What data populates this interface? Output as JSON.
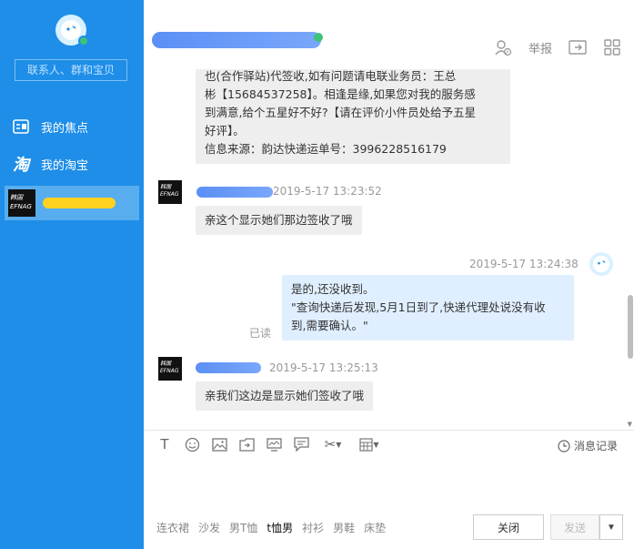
{
  "sidebar": {
    "search_placeholder": "联系人、群和宝贝",
    "nav": [
      {
        "label": "我的焦点",
        "icon": "focus-icon"
      },
      {
        "label": "我的淘宝",
        "icon": "taobao-icon"
      }
    ],
    "active_contact_logo_text": "韩国 EFNAG"
  },
  "header": {
    "report_label": "举报",
    "icons": [
      "user-add-icon",
      "report-label",
      "share-icon",
      "apps-icon"
    ]
  },
  "messages": {
    "first_bubble_lines": [
      "也(合作驿站)代签收,如有问题请电联业务员：王总",
      "彬【15684537258】。相逢是缘,如果您对我的服务感",
      "到满意,给个五星好不好?【请在评价小件员处给予五星",
      "好评】。",
      "信息来源：韵达快递运单号：3996228516179"
    ],
    "msg2": {
      "time": "2019-5-17 13:23:52",
      "text": "亲这个显示她们那边签收了哦"
    },
    "msg3": {
      "time": "2019-5-17 13:24:38",
      "lines": [
        "是的,还没收到。",
        "\"查询快递后发现,5月1日到了,快递代理处说没有收",
        "到,需要确认。\""
      ],
      "read": "已读"
    },
    "msg4": {
      "time": "2019-5-17 13:25:13",
      "text": "亲我们这边是显示她们签收了哦"
    }
  },
  "toolbar": {
    "icons": [
      "font-icon",
      "emoji-icon",
      "image-icon",
      "folder-icon",
      "screen-icon",
      "comment-icon",
      "scissors-icon",
      "grid-icon"
    ],
    "history_label": "消息记录"
  },
  "quick_words": [
    "连衣裙",
    "沙发",
    "男T恤",
    "t恤男",
    "衬衫",
    "男鞋",
    "床垫"
  ],
  "buttons": {
    "close": "关闭",
    "send": "发送",
    "send_more": "▼"
  }
}
